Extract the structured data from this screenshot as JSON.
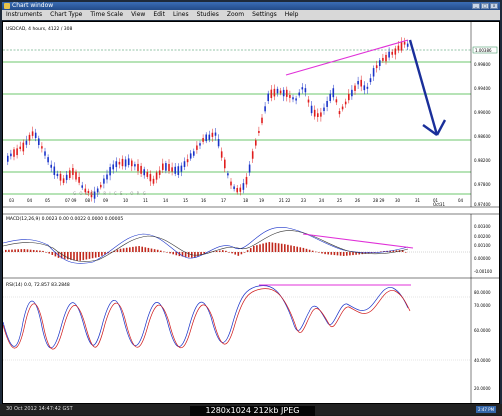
{
  "window": {
    "title": "Chart window"
  },
  "menu": [
    "Instruments",
    "Chart Type",
    "Time Scale",
    "View",
    "Edit",
    "Lines",
    "Studies",
    "Zoom",
    "Settings",
    "Help"
  ],
  "price_panel": {
    "header": "USDCAD, 4 hours, 4122 / 308",
    "watermark": "G O L D P R I C E . O R G",
    "y_labels": [
      "1.00386",
      "0.99800",
      "0.99400",
      "0.99000",
      "0.98600",
      "0.98200",
      "0.97800",
      "0.97400"
    ],
    "current_price": "1.00386",
    "x_labels": [
      "03",
      "04",
      "05",
      "07 09",
      "08",
      "09",
      "10",
      "11",
      "14",
      "15",
      "16",
      "17",
      "18",
      "19",
      "21 22",
      "23",
      "24",
      "25",
      "26",
      "28 29",
      "30",
      "31",
      "01",
      "Oct31",
      "04"
    ]
  },
  "macd_panel": {
    "header": "MACD(12,26,9) 0.0023 0.00 0.0022 0.0000 0.00005",
    "y_labels": [
      "0.00300",
      "0.00200",
      "0.00100",
      "0.00000",
      "-0.00100"
    ]
  },
  "rsi_panel": {
    "header": "RSI(14) 0.0, 72.857 83.2848",
    "y_labels": [
      "80.0000",
      "70.0000",
      "60.0000",
      "40.0000",
      "20.0000"
    ]
  },
  "status": {
    "datetime": "30 Oct 2012 14:47:42 GST",
    "clock": "2:47 PM"
  },
  "image_overlay": "1280x1024  212kb  JPEG",
  "colors": {
    "bull": "#1a33c9",
    "bear": "#e01d1d",
    "trendline": "#e030d8",
    "arrow": "#1a2f9a",
    "hline": "#3cb43c"
  }
}
